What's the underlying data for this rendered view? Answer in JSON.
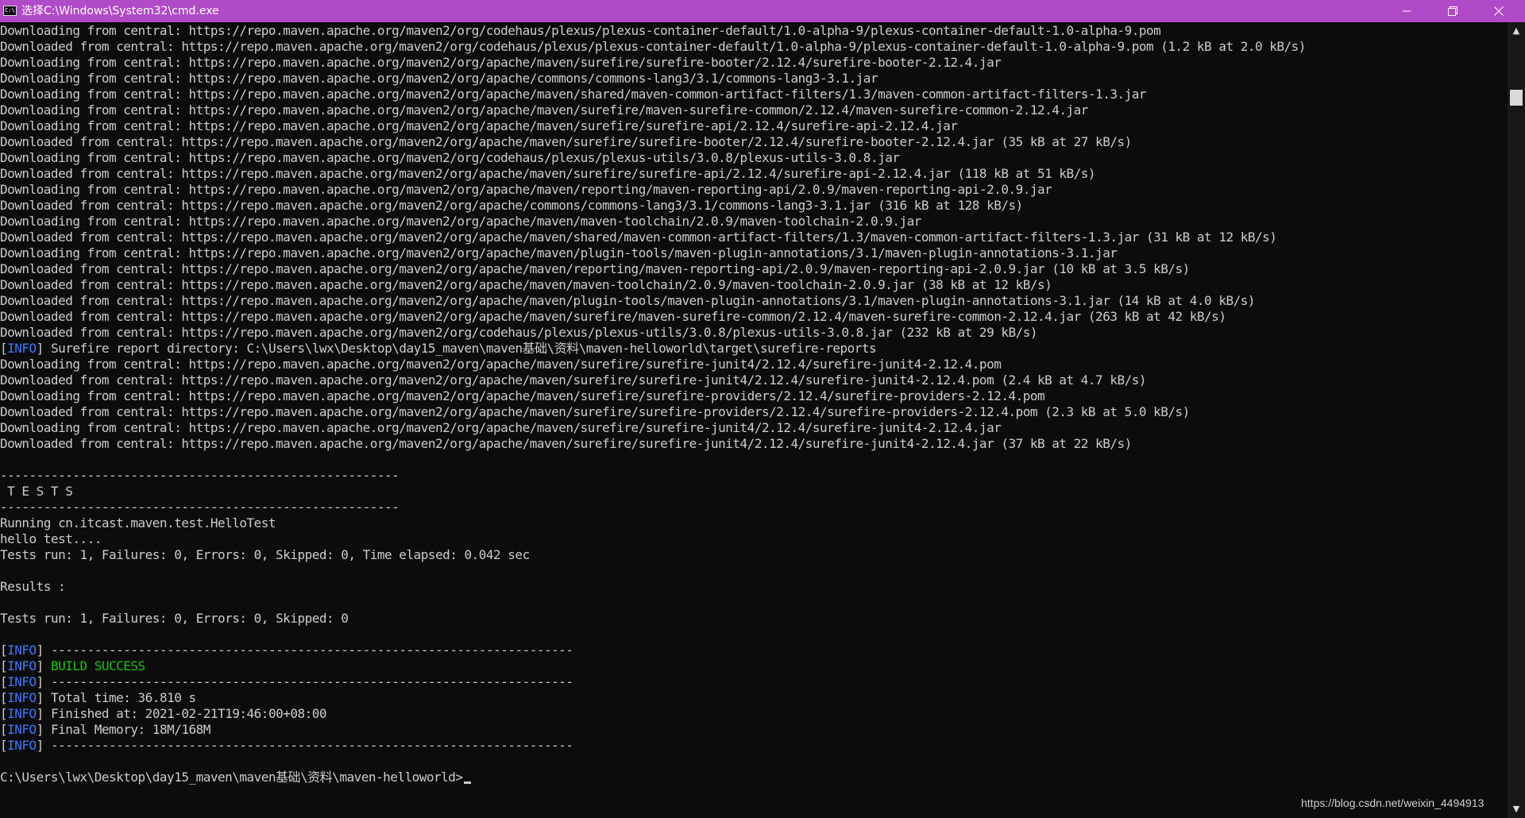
{
  "window": {
    "title": "选择C:\\Windows\\System32\\cmd.exe",
    "app_icon_text": "C:\\",
    "accent_color": "#b04ac6",
    "buttons": {
      "minimize_glyph": "—",
      "maximize_glyph": "❐",
      "close_glyph": "✕"
    }
  },
  "console": {
    "text_color": "#cccccc",
    "info_color": "#3b78ff",
    "success_color": "#16c60c",
    "download_lines": [
      "Downloading from central: https://repo.maven.apache.org/maven2/org/codehaus/plexus/plexus-container-default/1.0-alpha-9/plexus-container-default-1.0-alpha-9.pom",
      "Downloaded from central: https://repo.maven.apache.org/maven2/org/codehaus/plexus/plexus-container-default/1.0-alpha-9/plexus-container-default-1.0-alpha-9.pom (1.2 kB at 2.0 kB/s)",
      "Downloading from central: https://repo.maven.apache.org/maven2/org/apache/maven/surefire/surefire-booter/2.12.4/surefire-booter-2.12.4.jar",
      "Downloading from central: https://repo.maven.apache.org/maven2/org/apache/commons/commons-lang3/3.1/commons-lang3-3.1.jar",
      "Downloading from central: https://repo.maven.apache.org/maven2/org/apache/maven/shared/maven-common-artifact-filters/1.3/maven-common-artifact-filters-1.3.jar",
      "Downloading from central: https://repo.maven.apache.org/maven2/org/apache/maven/surefire/maven-surefire-common/2.12.4/maven-surefire-common-2.12.4.jar",
      "Downloading from central: https://repo.maven.apache.org/maven2/org/apache/maven/surefire/surefire-api/2.12.4/surefire-api-2.12.4.jar",
      "Downloaded from central: https://repo.maven.apache.org/maven2/org/apache/maven/surefire/surefire-booter/2.12.4/surefire-booter-2.12.4.jar (35 kB at 27 kB/s)",
      "Downloading from central: https://repo.maven.apache.org/maven2/org/codehaus/plexus/plexus-utils/3.0.8/plexus-utils-3.0.8.jar",
      "Downloaded from central: https://repo.maven.apache.org/maven2/org/apache/maven/surefire/surefire-api/2.12.4/surefire-api-2.12.4.jar (118 kB at 51 kB/s)",
      "Downloading from central: https://repo.maven.apache.org/maven2/org/apache/maven/reporting/maven-reporting-api/2.0.9/maven-reporting-api-2.0.9.jar",
      "Downloaded from central: https://repo.maven.apache.org/maven2/org/apache/commons/commons-lang3/3.1/commons-lang3-3.1.jar (316 kB at 128 kB/s)",
      "Downloading from central: https://repo.maven.apache.org/maven2/org/apache/maven/maven-toolchain/2.0.9/maven-toolchain-2.0.9.jar",
      "Downloaded from central: https://repo.maven.apache.org/maven2/org/apache/maven/shared/maven-common-artifact-filters/1.3/maven-common-artifact-filters-1.3.jar (31 kB at 12 kB/s)",
      "Downloading from central: https://repo.maven.apache.org/maven2/org/apache/maven/plugin-tools/maven-plugin-annotations/3.1/maven-plugin-annotations-3.1.jar",
      "Downloaded from central: https://repo.maven.apache.org/maven2/org/apache/maven/reporting/maven-reporting-api/2.0.9/maven-reporting-api-2.0.9.jar (10 kB at 3.5 kB/s)",
      "Downloaded from central: https://repo.maven.apache.org/maven2/org/apache/maven/maven-toolchain/2.0.9/maven-toolchain-2.0.9.jar (38 kB at 12 kB/s)",
      "Downloaded from central: https://repo.maven.apache.org/maven2/org/apache/maven/plugin-tools/maven-plugin-annotations/3.1/maven-plugin-annotations-3.1.jar (14 kB at 4.0 kB/s)",
      "Downloaded from central: https://repo.maven.apache.org/maven2/org/apache/maven/surefire/maven-surefire-common/2.12.4/maven-surefire-common-2.12.4.jar (263 kB at 42 kB/s)",
      "Downloaded from central: https://repo.maven.apache.org/maven2/org/codehaus/plexus/plexus-utils/3.0.8/plexus-utils-3.0.8.jar (232 kB at 29 kB/s)"
    ],
    "surefire_report_line": {
      "text": "Surefire report directory: C:\\Users\\lwx\\Desktop\\day15_maven\\maven基础\\资料\\maven-helloworld\\target\\surefire-reports"
    },
    "junit_lines": [
      "Downloading from central: https://repo.maven.apache.org/maven2/org/apache/maven/surefire/surefire-junit4/2.12.4/surefire-junit4-2.12.4.pom",
      "Downloaded from central: https://repo.maven.apache.org/maven2/org/apache/maven/surefire/surefire-junit4/2.12.4/surefire-junit4-2.12.4.pom (2.4 kB at 4.7 kB/s)",
      "Downloading from central: https://repo.maven.apache.org/maven2/org/apache/maven/surefire/surefire-providers/2.12.4/surefire-providers-2.12.4.pom",
      "Downloaded from central: https://repo.maven.apache.org/maven2/org/apache/maven/surefire/surefire-providers/2.12.4/surefire-providers-2.12.4.pom (2.3 kB at 5.0 kB/s)",
      "Downloading from central: https://repo.maven.apache.org/maven2/org/apache/maven/surefire/surefire-junit4/2.12.4/surefire-junit4-2.12.4.jar",
      "Downloaded from central: https://repo.maven.apache.org/maven2/org/apache/maven/surefire/surefire-junit4/2.12.4/surefire-junit4-2.12.4.jar (37 kB at 22 kB/s)"
    ],
    "tests_section": {
      "separator": "-------------------------------------------------------",
      "header": " T E S T S",
      "lines": [
        "Running cn.itcast.maven.test.HelloTest",
        "hello test....",
        "Tests run: 1, Failures: 0, Errors: 0, Skipped: 0, Time elapsed: 0.042 sec"
      ],
      "results_label": "Results :",
      "summary": "Tests run: 1, Failures: 0, Errors: 0, Skipped: 0"
    },
    "build_summary": {
      "info_word": "INFO",
      "separator": "------------------------------------------------------------------------",
      "build_status": "BUILD SUCCESS",
      "total_time": "Total time: 36.810 s",
      "finished_at": "Finished at: 2021-02-21T19:46:00+08:00",
      "final_memory": "Final Memory: 18M/168M"
    },
    "prompt": "C:\\Users\\lwx\\Desktop\\day15_maven\\maven基础\\资料\\maven-helloworld>"
  },
  "scrollbar": {
    "up_glyph": "▲",
    "down_glyph": "▼"
  },
  "watermark": "https://blog.csdn.net/weixin_4494913"
}
